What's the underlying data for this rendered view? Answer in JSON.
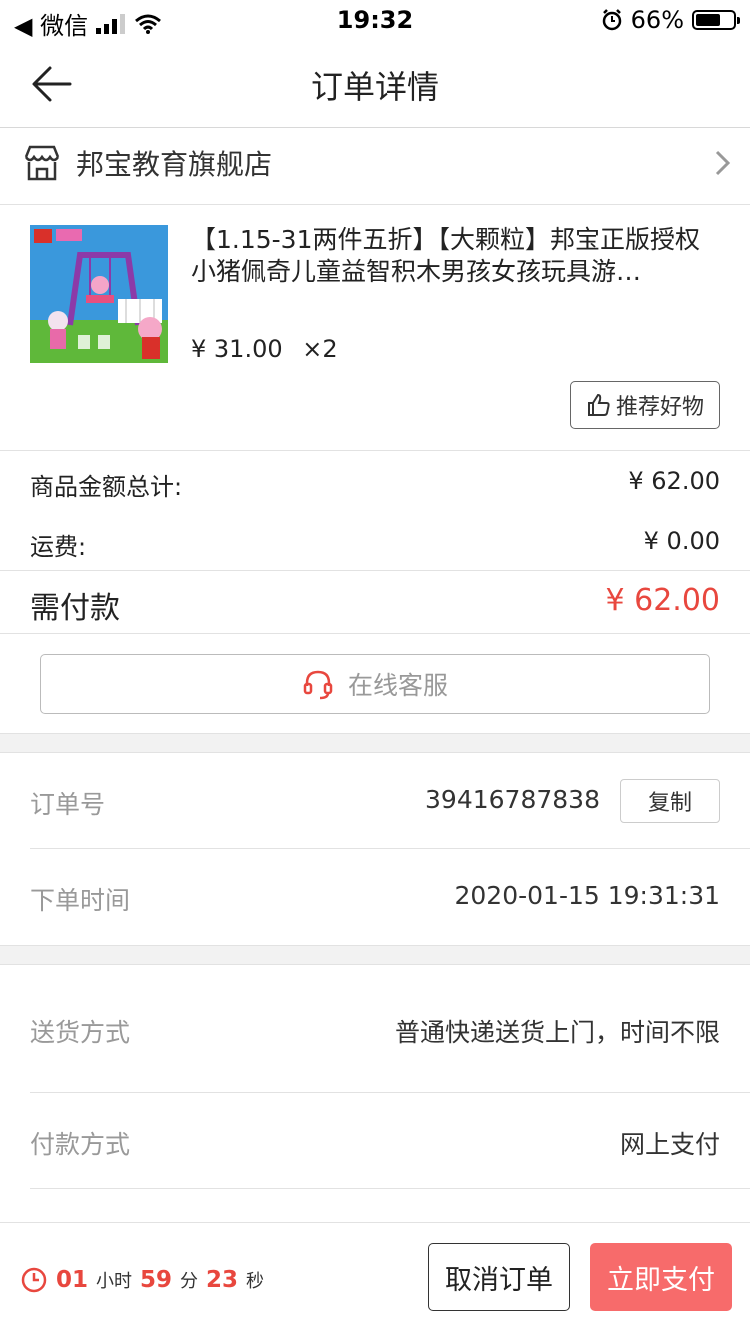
{
  "status_bar": {
    "carrier": "◀ 微信",
    "time": "19:32",
    "battery_percent": "66%",
    "battery_level": 0.66
  },
  "nav": {
    "title": "订单详情"
  },
  "store": {
    "name": "邦宝教育旗舰店"
  },
  "product": {
    "title": "【1.15-31两件五折】【大颗粒】邦宝正版授权小猪佩奇儿童益智积木男孩女孩玩具游…",
    "price": "¥ 31.00",
    "quantity": "×2",
    "recommend_label": "推荐好物"
  },
  "summary": {
    "goods_total_label": "商品金额总计:",
    "goods_total_value": "¥ 62.00",
    "shipping_label": "运费:",
    "shipping_value": "¥ 0.00",
    "due_label": "需付款",
    "due_value": "¥ 62.00"
  },
  "service": {
    "label": "在线客服"
  },
  "order": {
    "number_label": "订单号",
    "number_value": "39416787838",
    "copy_label": "复制",
    "time_label": "下单时间",
    "time_value": "2020-01-15 19:31:31"
  },
  "delivery": {
    "method_label": "送货方式",
    "method_value": "普通快递送货上门，时间不限",
    "payment_label": "付款方式",
    "payment_value": "网上支付"
  },
  "bottom": {
    "hours": "01",
    "hours_unit": "小时",
    "minutes": "59",
    "minutes_unit": "分",
    "seconds": "23",
    "seconds_unit": "秒",
    "cancel_label": "取消订单",
    "pay_label": "立即支付"
  },
  "colors": {
    "accent": "#e8473e",
    "pay_button": "#f76b6b"
  }
}
